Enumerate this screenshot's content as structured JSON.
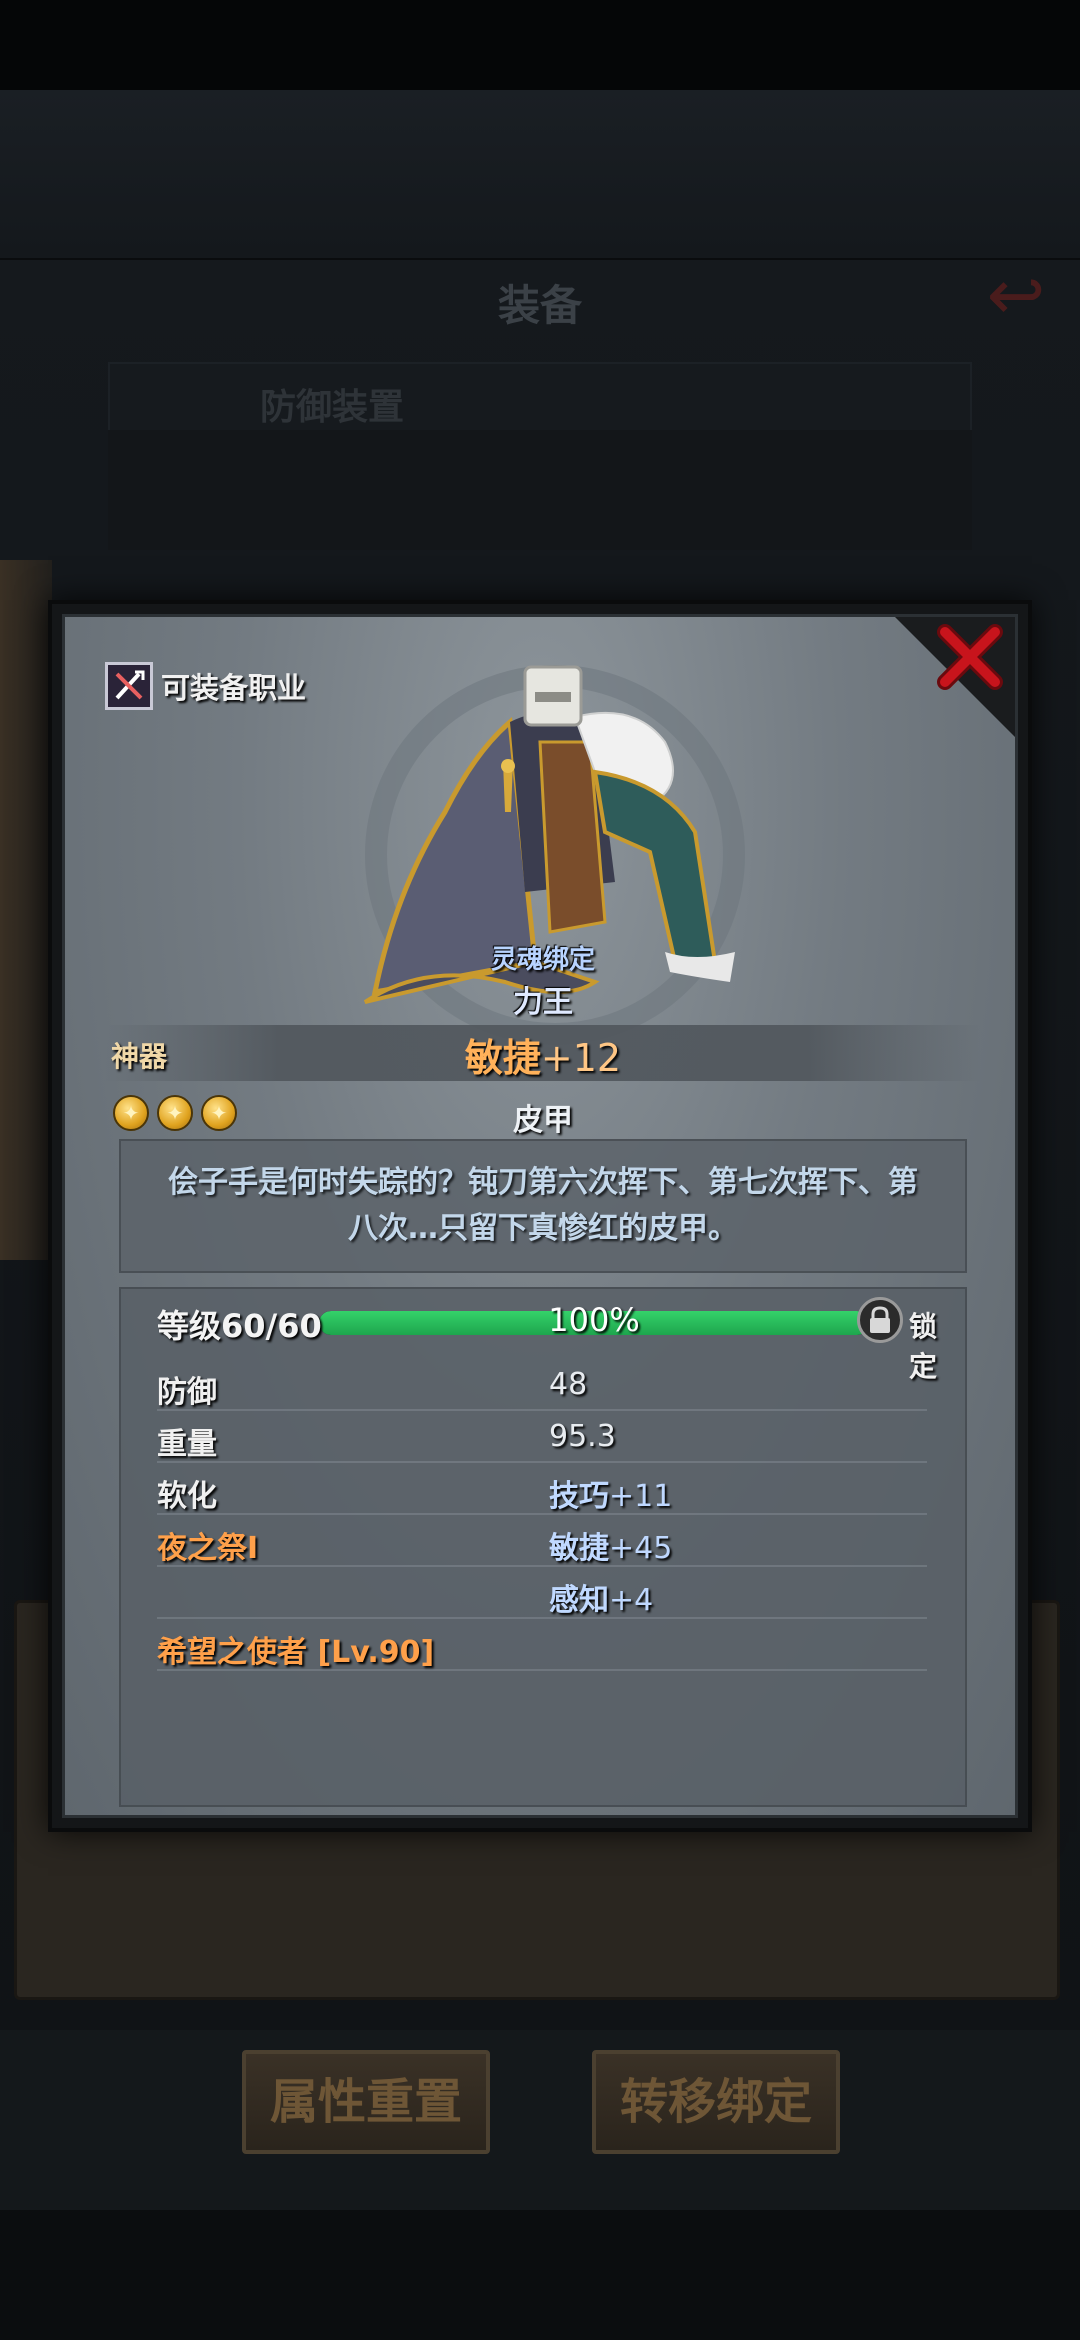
{
  "background": {
    "title": "装备",
    "header_left": "防御装置",
    "header_right": "",
    "buttons": {
      "reset_label": "属性重置",
      "transfer_label": "转移绑定"
    }
  },
  "modal": {
    "class_label": "可装备职业",
    "item": {
      "bind_status": "灵魂绑定",
      "name": "力王",
      "grade": "神器",
      "main_stat_name": "敏捷",
      "main_stat_value": "+12",
      "star_count": 3,
      "type": "皮甲",
      "description": "侩子手是何时失踪的？钝刀第六次挥下、第七次挥下、第八次…只留下真惨红的皮甲。"
    },
    "level": {
      "label": "等级",
      "current": "60/60",
      "progress_text": "100%",
      "progress": 1.0,
      "lock_label": "锁定"
    },
    "stats": [
      {
        "key": "防御",
        "key_color": "white",
        "value_name": "",
        "value": "48",
        "value_style": "white"
      },
      {
        "key": "重量",
        "key_color": "white",
        "value_name": "",
        "value": "95.3",
        "value_style": "white"
      },
      {
        "key": "软化",
        "key_color": "white",
        "value_name": "技巧",
        "value": "+11",
        "value_style": "blue"
      },
      {
        "key": "夜之祭I",
        "key_color": "orange",
        "value_name": "敏捷",
        "value": "+45",
        "value_style": "blue"
      },
      {
        "key": "",
        "key_color": "white",
        "value_name": "感知",
        "value": "+4",
        "value_style": "blue"
      }
    ],
    "set_label": "希望之使者 [Lv.90]",
    "colors": {
      "grade": "#f0d8a8",
      "main_stat": "#ffb15a",
      "bind": "#b8d4ff",
      "xp_fill": "#34d26a",
      "close": "#c8141c"
    }
  }
}
